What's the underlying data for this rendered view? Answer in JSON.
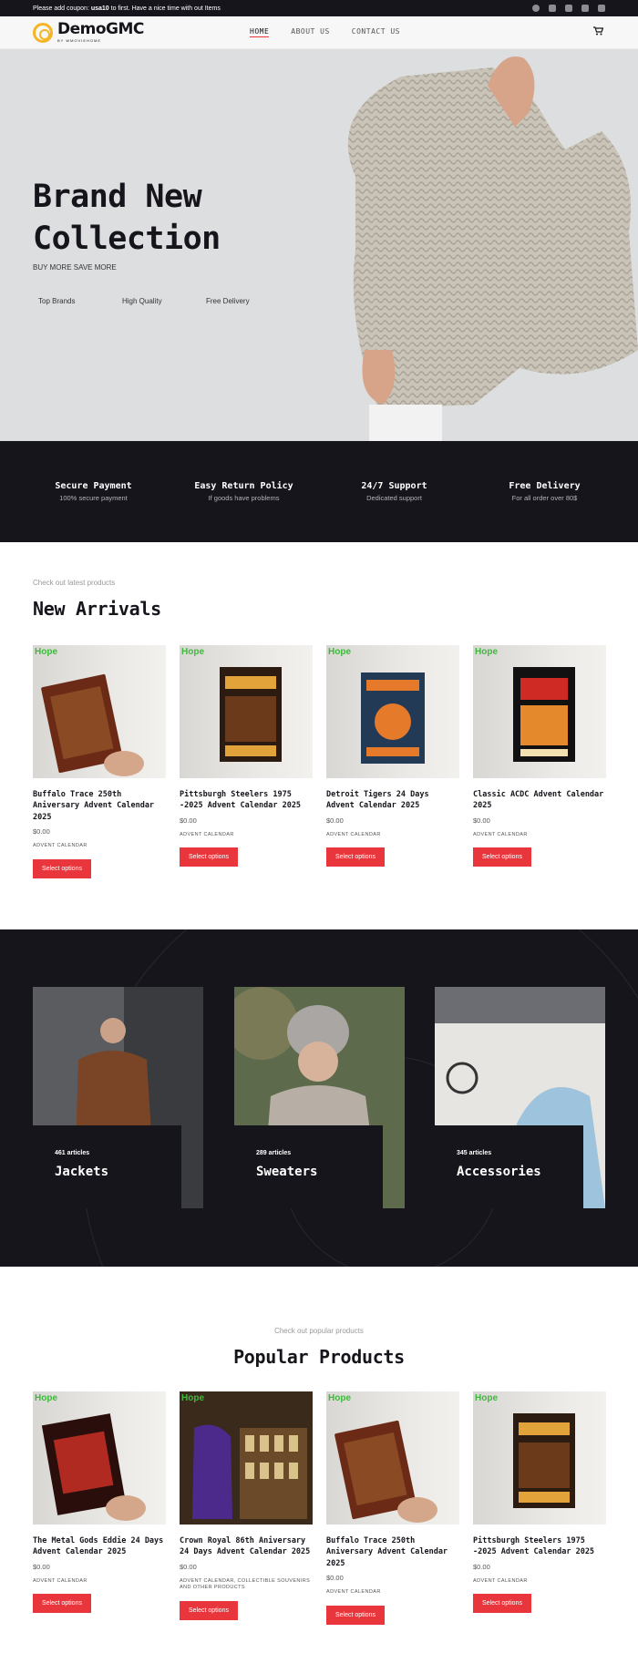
{
  "topbar": {
    "coupon_prefix": "Please add coupon: ",
    "coupon_code": "usa10",
    "coupon_suffix": " to first. Have a nice time with out Items",
    "social_icons": [
      "facebook-icon",
      "x-icon",
      "instagram-icon",
      "email-icon",
      "phone-icon"
    ]
  },
  "header": {
    "logo_name": "DemoGMC",
    "logo_sub": "BY WMOVIEHOME",
    "nav": [
      "HOME",
      "ABOUT US",
      "CONTACT US"
    ],
    "cart_icon": "cart-icon"
  },
  "hero": {
    "title_line1": "Brand New",
    "title_line2": "Collection",
    "subtitle": "BUY MORE SAVE MORE",
    "features": [
      "Top Brands",
      "High Quality",
      "Free Delivery"
    ]
  },
  "features": [
    {
      "title": "Secure Payment",
      "desc": "100% secure payment"
    },
    {
      "title": "Easy Return Policy",
      "desc": "If goods have problems"
    },
    {
      "title": "24/7 Support",
      "desc": "Dedicated support"
    },
    {
      "title": "Free Delivery",
      "desc": "For all order over 80$"
    }
  ],
  "arrivals": {
    "eyebrow": "Check out latest products",
    "title": "New Arrivals",
    "products": [
      {
        "brand": "Hope",
        "name": "Buffalo Trace 250th Aniversary Advent Calendar 2025",
        "price": "$0.00",
        "category": "ADVENT CALENDAR",
        "button": "Select options"
      },
      {
        "brand": "Hope",
        "name": "Pittsburgh Steelers 1975 -2025 Advent Calendar 2025",
        "price": "$0.00",
        "category": "ADVENT CALENDAR",
        "button": "Select options"
      },
      {
        "brand": "Hope",
        "name": "Detroit Tigers 24 Days Advent Calendar 2025",
        "price": "$0.00",
        "category": "ADVENT CALENDAR",
        "button": "Select options"
      },
      {
        "brand": "Hope",
        "name": "Classic ACDC Advent Calendar 2025",
        "price": "$0.00",
        "category": "ADVENT CALENDAR",
        "button": "Select options"
      }
    ]
  },
  "categories": [
    {
      "count": "461 articles",
      "name": "Jackets"
    },
    {
      "count": "289 articles",
      "name": "Sweaters"
    },
    {
      "count": "345 articles",
      "name": "Accessories"
    }
  ],
  "popular": {
    "eyebrow": "Check out popular products",
    "title": "Popular Products",
    "products": [
      {
        "brand": "Hope",
        "name": "The Metal Gods Eddie 24 Days Advent Calendar 2025",
        "price": "$0.00",
        "category": "ADVENT CALENDAR",
        "button": "Select options"
      },
      {
        "brand": "Hope",
        "name": "Crown Royal 86th Aniversary 24 Days Advent Calendar 2025",
        "price": "$0.00",
        "category": "ADVENT CALENDAR, COLLECTIBLE SOUVENIRS AND OTHER PRODUCTS",
        "button": "Select options"
      },
      {
        "brand": "Hope",
        "name": "Buffalo Trace 250th Aniversary Advent Calendar 2025",
        "price": "$0.00",
        "category": "ADVENT CALENDAR",
        "button": "Select options"
      },
      {
        "brand": "Hope",
        "name": "Pittsburgh Steelers 1975 -2025 Advent Calendar 2025",
        "price": "$0.00",
        "category": "ADVENT CALENDAR",
        "button": "Select options"
      }
    ]
  },
  "colors": {
    "dark": "#17151c",
    "accent_red": "#e8363c",
    "logo_yellow": "#f4b624",
    "brand_green": "#3fb93c"
  }
}
